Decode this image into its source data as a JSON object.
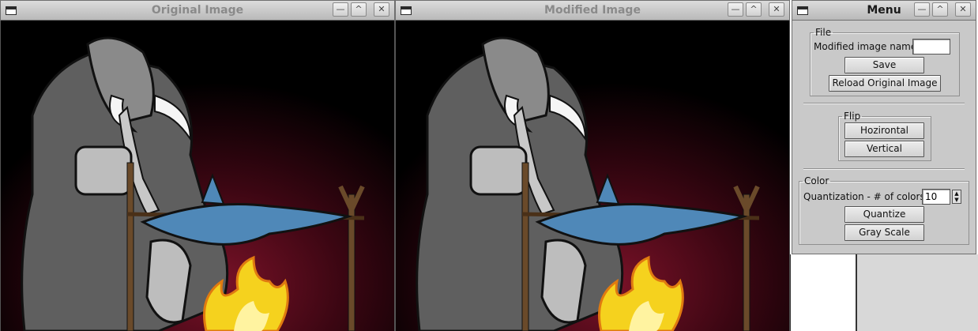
{
  "windows": {
    "original": {
      "title": "Original Image",
      "buttons": {
        "minimize": "—",
        "maximize": "^",
        "close": "✕"
      }
    },
    "modified": {
      "title": "Modified Image",
      "buttons": {
        "minimize": "—",
        "maximize": "^",
        "close": "✕"
      }
    },
    "menu": {
      "title": "Menu",
      "buttons": {
        "minimize": "—",
        "maximize": "^",
        "close": "✕"
      }
    }
  },
  "menu": {
    "file": {
      "legend": "File",
      "name_label": "Modified image name:",
      "name_value": "",
      "save_label": "Save",
      "reload_label": "Reload Original Image"
    },
    "flip": {
      "legend": "Flip",
      "horizontal_label": "Hozirontal",
      "vertical_label": "Vertical"
    },
    "color": {
      "legend": "Color",
      "quant_label": "Quantization - # of colors:",
      "quant_value": "10",
      "quantize_label": "Quantize",
      "gray_label": "Gray Scale"
    }
  },
  "colors": {
    "fish": "#4f88b8",
    "fire": "#f5d21e",
    "fire_dark": "#e07a10",
    "background_glow": "#5a0a1e",
    "panel": "#c9c9c9"
  }
}
